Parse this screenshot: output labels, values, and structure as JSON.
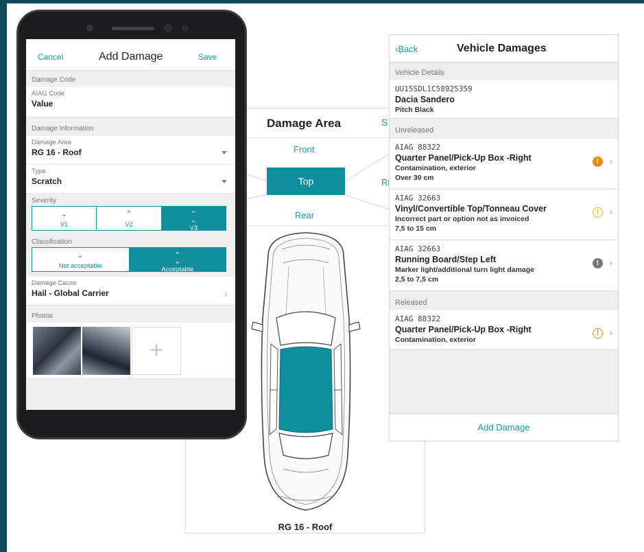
{
  "damage_area_panel": {
    "title": "Damage Area",
    "save_peek": "S",
    "right_peek": "Ri",
    "zones": {
      "front": "Front",
      "top": "Top",
      "rear": "Rear"
    },
    "caption": "RG 16 - Roof",
    "highlight_color": "#0f8e9b"
  },
  "phone": {
    "header": {
      "cancel": "Cancel",
      "title": "Add Damage",
      "save": "Save"
    },
    "sections": {
      "damage_code": "Damage Code",
      "damage_information": "Damage Information",
      "photos": "Photos"
    },
    "aiag_code": {
      "label": "AIAG Code",
      "value": "Value"
    },
    "damage_area": {
      "label": "Damage Area",
      "value": "RG 16 - Roof"
    },
    "type": {
      "label": "Type",
      "value": "Scratch"
    },
    "severity": {
      "label": "Severity",
      "options": [
        {
          "label": "V1",
          "icon": "chevron-down-icon"
        },
        {
          "label": "V2",
          "icon": "chevron-up-icon"
        },
        {
          "label": "V3",
          "icon": "double-chevron-up-icon"
        }
      ],
      "selected": "V3"
    },
    "classification": {
      "label": "Classification",
      "options": [
        {
          "label": "Not acceptable",
          "icon": "chevron-down-icon"
        },
        {
          "label": "Acceptable",
          "icon": "double-chevron-up-icon"
        }
      ],
      "selected": "Acceptable"
    },
    "damage_cause": {
      "label": "Damage Cause",
      "value": "Hail - Global Carrier"
    },
    "photos": {
      "count": 2,
      "add_icon": "plus-icon"
    }
  },
  "vehicle_damages": {
    "back": "Back",
    "title": "Vehicle Damages",
    "vehicle_details_header": "Vehicle Details",
    "vehicle": {
      "vin": "UU15SDL1C58925359",
      "model": "Dacia Sandero",
      "color": "Pitch Black"
    },
    "unreleased_header": "Unreleased",
    "unreleased": [
      {
        "code": "AIAG 88322",
        "part": "Quarter Panel/Pick-Up Box -Right",
        "detail": "Contamination, exterior",
        "size": "Over 30 cm",
        "indicator": "filled-orange"
      },
      {
        "code": "AIAG 32663",
        "part": "Vinyl/Convertible Top/Tonneau Cover",
        "detail": "Incorrect part or option not as invoiced",
        "size": "7,5 to 15 cm",
        "indicator": "outline-yellow"
      },
      {
        "code": "AIAG 32663",
        "part": "Running Board/Step Left",
        "detail": "Marker light/additional turn light damage",
        "size": "2,5 to 7,5 cm",
        "indicator": "filled-gray"
      }
    ],
    "released_header": "Released",
    "released": [
      {
        "code": "AIAG 88322",
        "part": "Quarter Panel/Pick-Up Box -Right",
        "detail": "Contamination, exterior",
        "indicator": "outline-orange"
      }
    ],
    "add_damage": "Add Damage"
  },
  "colors": {
    "accent": "#0f8e9b",
    "link": "#1a9aa8",
    "frame": "#0d4a59",
    "warn_orange": "#e8891a",
    "warn_yellow": "#c9c21d",
    "neutral_gray": "#777777"
  }
}
